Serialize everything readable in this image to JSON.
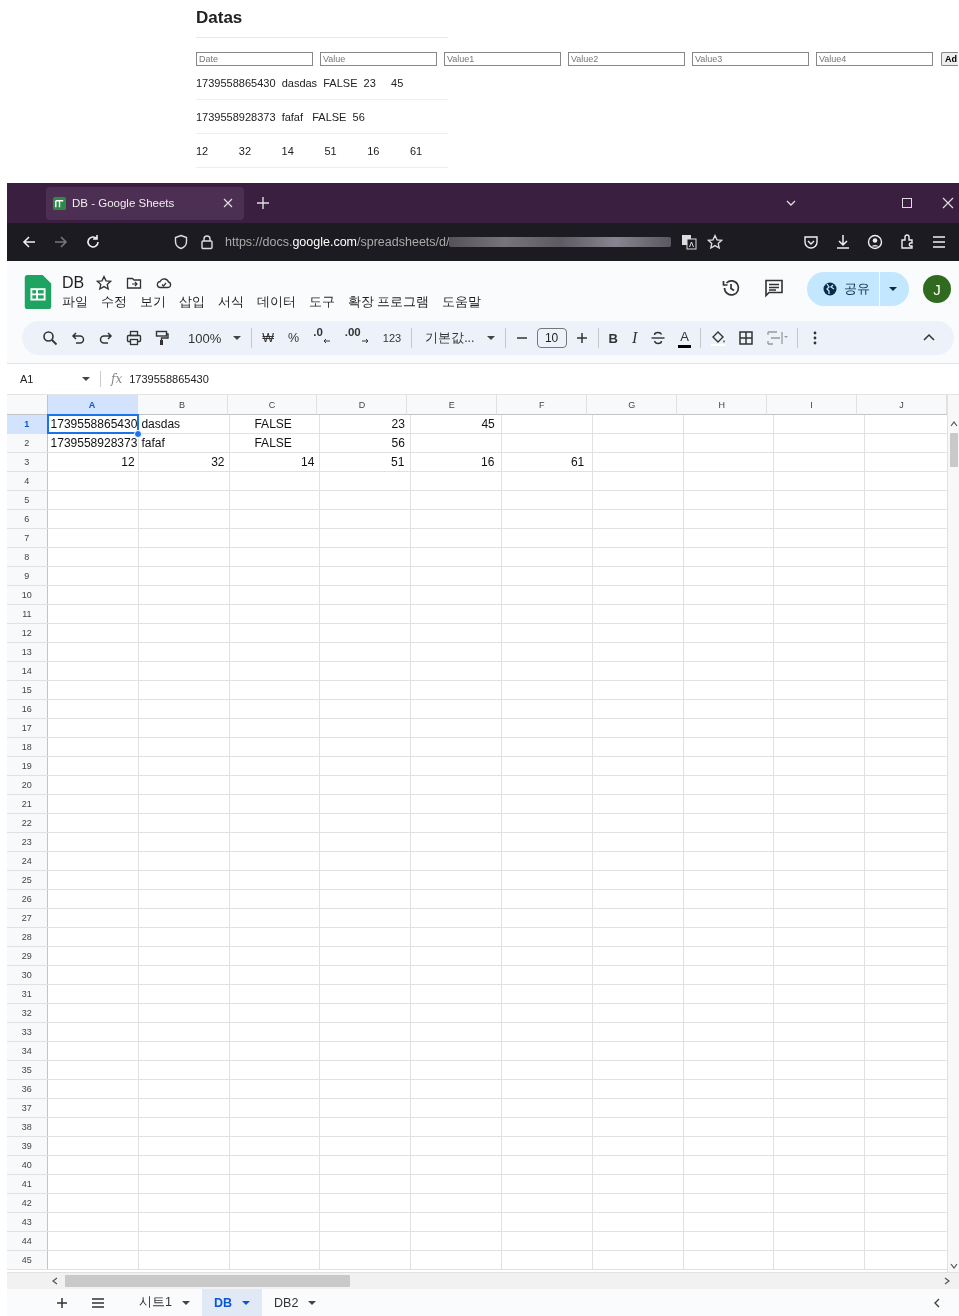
{
  "page": {
    "title": "Datas",
    "inputs": [
      {
        "placeholder": "Date"
      },
      {
        "placeholder": "Value"
      },
      {
        "placeholder": "Value1"
      },
      {
        "placeholder": "Value2"
      },
      {
        "placeholder": "Value3"
      },
      {
        "placeholder": "Value4"
      }
    ],
    "add_button": "Ad",
    "rows": [
      "1739558865430  dasdas  FALSE  23     45",
      "1739558928373  fafaf   FALSE  56",
      "12          32          14          51          16          61"
    ]
  },
  "browser": {
    "tab_title": "DB - Google Sheets",
    "url_start": "https://docs.",
    "url_domain": "google.com",
    "url_path": "/spreadsheets/d/"
  },
  "sheets": {
    "doc_title": "DB",
    "menu": [
      "파일",
      "수정",
      "보기",
      "삽입",
      "서식",
      "데이터",
      "도구",
      "확장 프로그램",
      "도움말"
    ],
    "share": "공유",
    "avatar": "J",
    "toolbar": {
      "zoom": "100%",
      "currency": "₩",
      "percent": "%",
      "decrease_decimal": ".0",
      "increase_decimal": ".00",
      "number_format": "123",
      "font": "기본값...",
      "font_size": "10",
      "bold": "B",
      "italic": "I",
      "text_color": "A"
    },
    "cell_ref": "A1",
    "function_label": "fx",
    "formula": "1739558865430",
    "columns": [
      {
        "label": "A",
        "selected": true
      },
      {
        "label": "B",
        "selected": false
      },
      {
        "label": "C",
        "selected": false
      },
      {
        "label": "D",
        "selected": false
      },
      {
        "label": "E",
        "selected": false
      },
      {
        "label": "F",
        "selected": false
      },
      {
        "label": "G",
        "selected": false
      },
      {
        "label": "H",
        "selected": false
      },
      {
        "label": "I",
        "selected": false
      },
      {
        "label": "J",
        "selected": false
      }
    ],
    "rows": [
      {
        "number": "1",
        "selected": true,
        "cells": [
          {
            "text": "1739558865430",
            "kind": "number"
          },
          {
            "text": "dasdas",
            "kind": "text"
          },
          {
            "text": "FALSE",
            "kind": "boolean"
          },
          {
            "text": "23",
            "kind": "number"
          },
          {
            "text": "45",
            "kind": "number"
          }
        ]
      },
      {
        "number": "2",
        "selected": false,
        "cells": [
          {
            "text": "1739558928373",
            "kind": "number"
          },
          {
            "text": "fafaf",
            "kind": "text"
          },
          {
            "text": "FALSE",
            "kind": "boolean"
          },
          {
            "text": "56",
            "kind": "number"
          }
        ]
      },
      {
        "number": "3",
        "selected": false,
        "cells": [
          {
            "text": "12",
            "kind": "number"
          },
          {
            "text": "32",
            "kind": "number"
          },
          {
            "text": "14",
            "kind": "number"
          },
          {
            "text": "51",
            "kind": "number"
          },
          {
            "text": "16",
            "kind": "number"
          },
          {
            "text": "61",
            "kind": "number"
          }
        ]
      },
      {
        "number": "4",
        "selected": false
      },
      {
        "number": "5",
        "selected": false
      },
      {
        "number": "6",
        "selected": false
      },
      {
        "number": "7",
        "selected": false
      },
      {
        "number": "8",
        "selected": false
      },
      {
        "number": "9",
        "selected": false
      },
      {
        "number": "10",
        "selected": false
      },
      {
        "number": "11",
        "selected": false
      },
      {
        "number": "12",
        "selected": false
      },
      {
        "number": "13",
        "selected": false
      },
      {
        "number": "14",
        "selected": false
      },
      {
        "number": "15",
        "selected": false
      },
      {
        "number": "16",
        "selected": false
      },
      {
        "number": "17",
        "selected": false
      },
      {
        "number": "18",
        "selected": false
      },
      {
        "number": "19",
        "selected": false
      },
      {
        "number": "20",
        "selected": false
      },
      {
        "number": "21",
        "selected": false
      },
      {
        "number": "22",
        "selected": false
      },
      {
        "number": "23",
        "selected": false
      },
      {
        "number": "24",
        "selected": false
      },
      {
        "number": "25",
        "selected": false
      },
      {
        "number": "26",
        "selected": false
      },
      {
        "number": "27",
        "selected": false
      },
      {
        "number": "28",
        "selected": false
      },
      {
        "number": "29",
        "selected": false
      },
      {
        "number": "30",
        "selected": false
      },
      {
        "number": "31",
        "selected": false
      },
      {
        "number": "32",
        "selected": false
      },
      {
        "number": "33",
        "selected": false
      },
      {
        "number": "34",
        "selected": false
      },
      {
        "number": "35",
        "selected": false
      },
      {
        "number": "36",
        "selected": false
      },
      {
        "number": "37",
        "selected": false
      },
      {
        "number": "38",
        "selected": false
      },
      {
        "number": "39",
        "selected": false
      },
      {
        "number": "40",
        "selected": false
      },
      {
        "number": "41",
        "selected": false
      },
      {
        "number": "42",
        "selected": false
      },
      {
        "number": "43",
        "selected": false
      },
      {
        "number": "44",
        "selected": false
      },
      {
        "number": "45",
        "selected": false
      }
    ],
    "sheet_tabs": [
      {
        "label": "시트1",
        "selected": false
      },
      {
        "label": "DB",
        "selected": true
      },
      {
        "label": "DB2",
        "selected": false
      }
    ]
  }
}
